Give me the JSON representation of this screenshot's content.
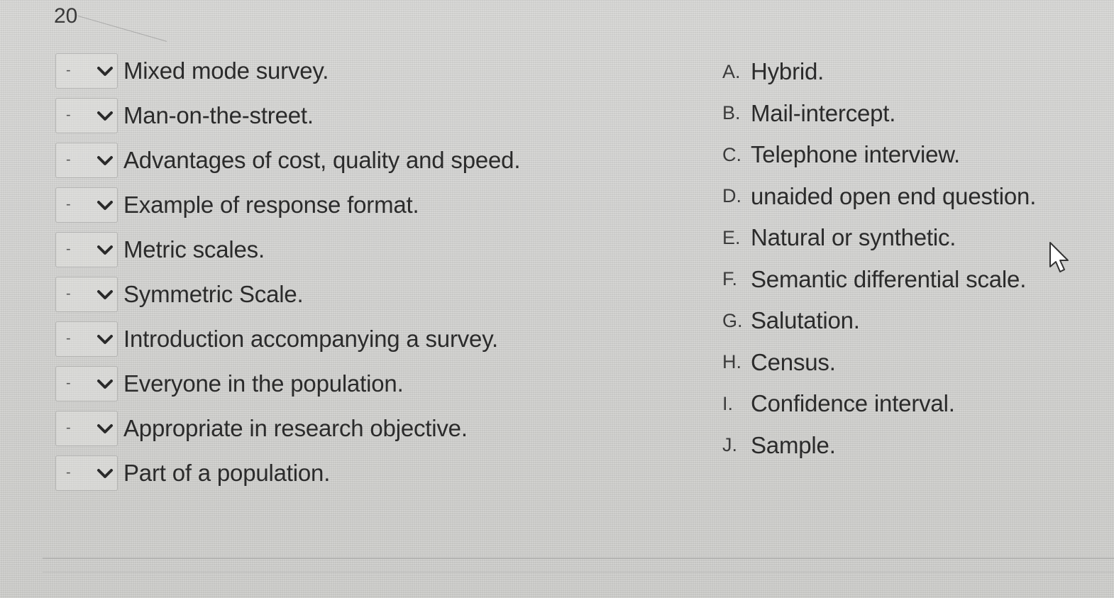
{
  "question": {
    "number": "20"
  },
  "matching_items": [
    {
      "selected": "-",
      "text": "Mixed mode survey."
    },
    {
      "selected": "-",
      "text": "Man-on-the-street."
    },
    {
      "selected": "-",
      "text": "Advantages of cost, quality and speed."
    },
    {
      "selected": "-",
      "text": "Example of response format."
    },
    {
      "selected": "-",
      "text": "Metric scales."
    },
    {
      "selected": "-",
      "text": "Symmetric Scale."
    },
    {
      "selected": "-",
      "text": "Introduction accompanying a survey."
    },
    {
      "selected": "-",
      "text": "Everyone in the population."
    },
    {
      "selected": "-",
      "text": "Appropriate in research objective."
    },
    {
      "selected": "-",
      "text": "Part of a population."
    }
  ],
  "answer_options": [
    {
      "letter": "A.",
      "text": "Hybrid."
    },
    {
      "letter": "B.",
      "text": "Mail-intercept."
    },
    {
      "letter": "C.",
      "text": "Telephone interview."
    },
    {
      "letter": "D.",
      "text": "unaided open end question."
    },
    {
      "letter": "E.",
      "text": "Natural or synthetic."
    },
    {
      "letter": "F.",
      "text": "Semantic differential scale."
    },
    {
      "letter": "G.",
      "text": "Salutation."
    },
    {
      "letter": "H.",
      "text": "Census."
    },
    {
      "letter": "I.",
      "text": "Confidence interval."
    },
    {
      "letter": "J.",
      "text": "Sample."
    }
  ],
  "icons": {
    "dropdown": "chevron-down-icon",
    "pointer": "pointer-cursor-icon"
  },
  "colors": {
    "background": "#d6d6d4",
    "text": "#2b2b2b"
  }
}
